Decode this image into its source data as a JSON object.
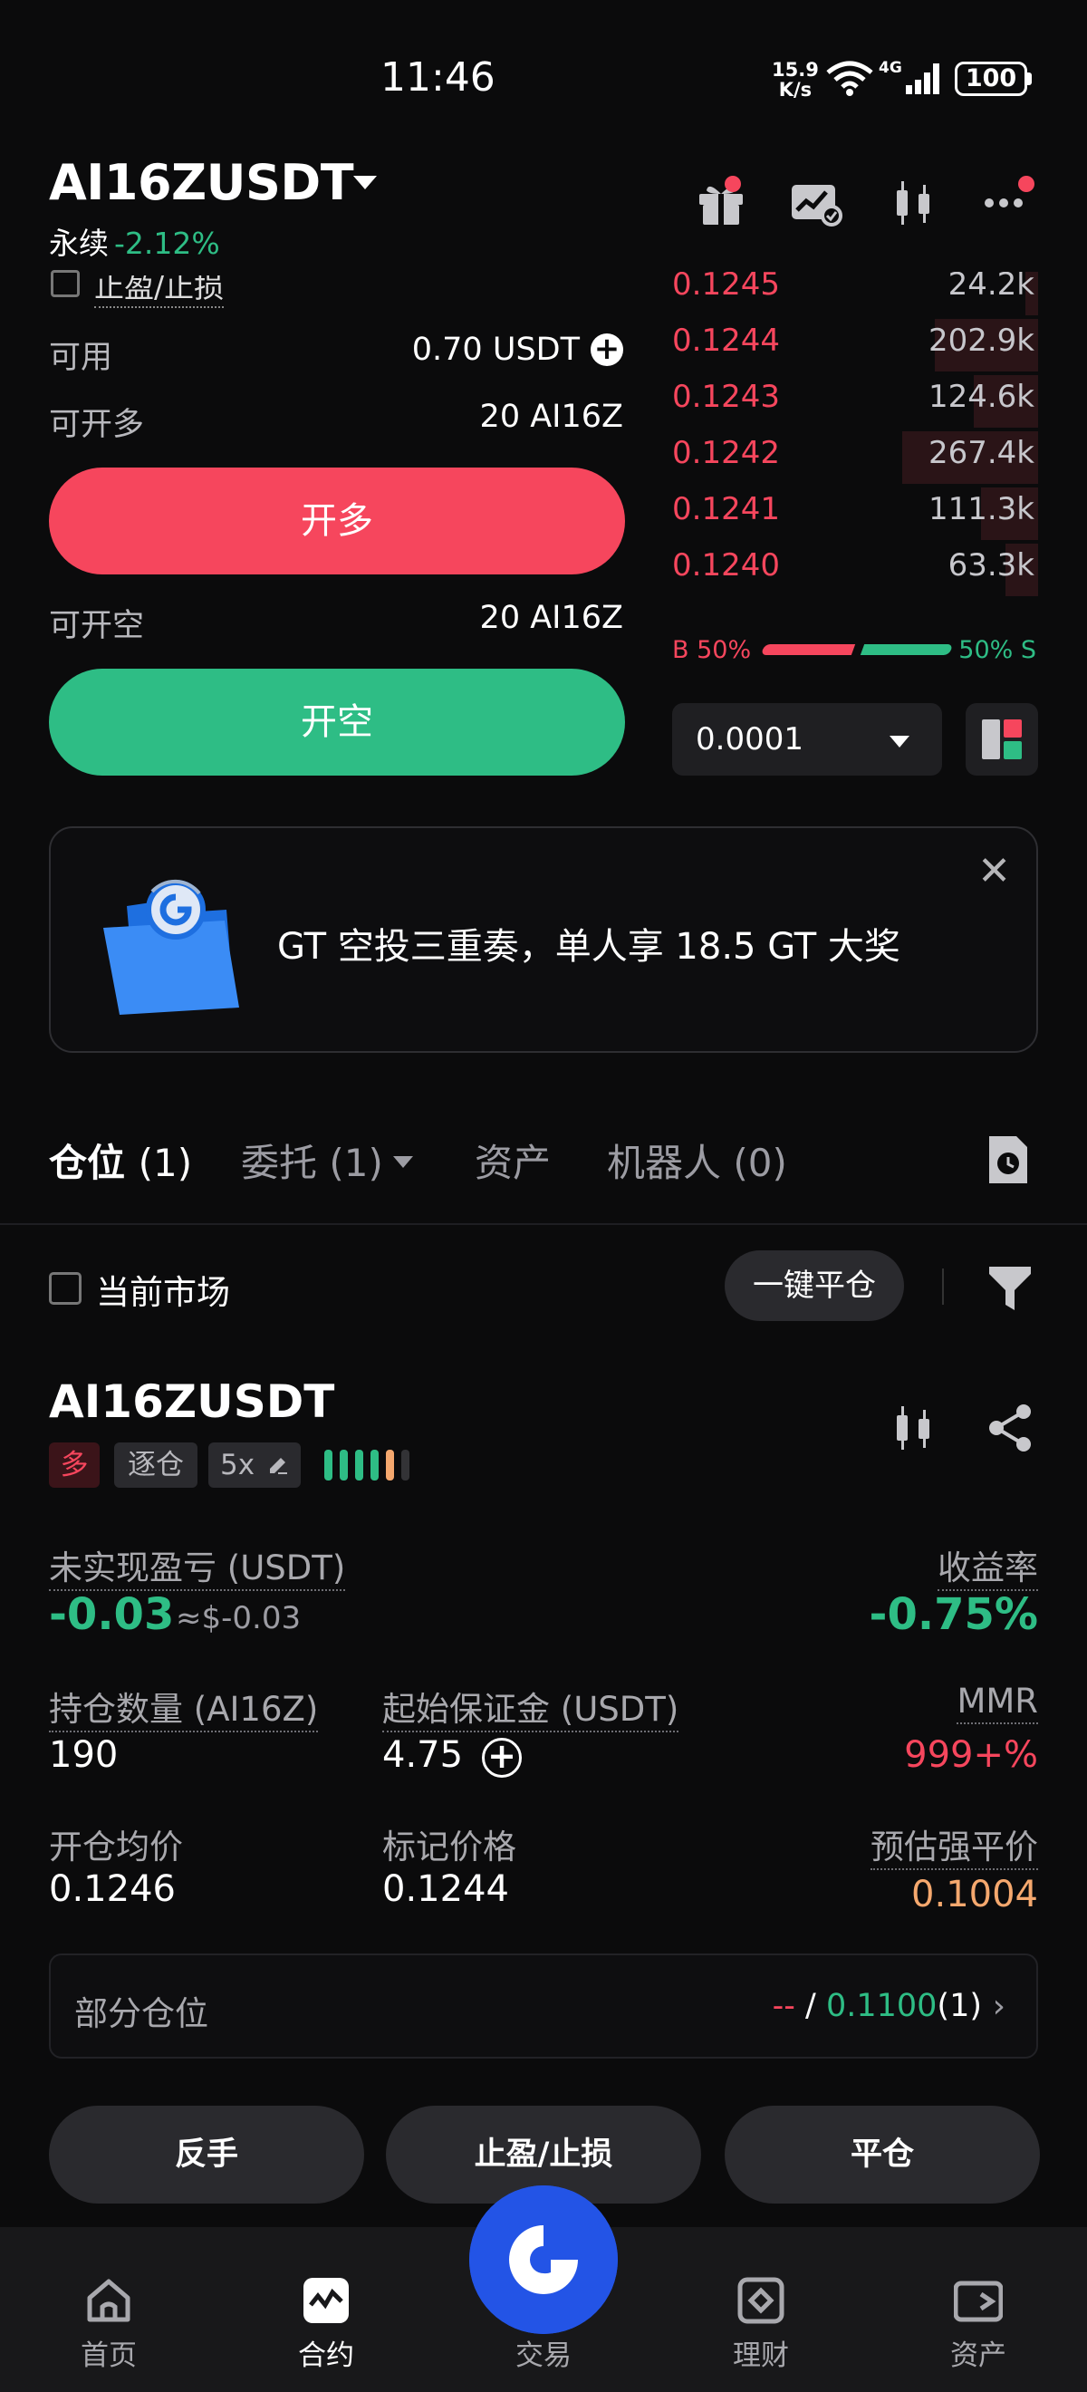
{
  "status_bar": {
    "time": "11:46",
    "net_speed_value": "15.9",
    "net_speed_unit": "K/s",
    "network": "4G",
    "battery": "100"
  },
  "header": {
    "pair": "AI16ZUSDT",
    "contract_type": "永续",
    "change": "-2.12%",
    "icons": [
      "gift-icon",
      "chart-alert-icon",
      "kline-icon",
      "more-icon"
    ]
  },
  "order_form": {
    "tpsl_label": "止盈/止损",
    "available_label": "可用",
    "available_value": "0.70 USDT",
    "max_long_label": "可开多",
    "max_long_value": "20 AI16Z",
    "open_long": "开多",
    "max_short_label": "可开空",
    "max_short_value": "20 AI16Z",
    "open_short": "开空"
  },
  "orderbook": {
    "asks": [
      {
        "price": "0.1245",
        "qty": "24.2k",
        "depth": 0.09
      },
      {
        "price": "0.1244",
        "qty": "202.9k",
        "depth": 0.76
      },
      {
        "price": "0.1243",
        "qty": "124.6k",
        "depth": 0.47
      },
      {
        "price": "0.1242",
        "qty": "267.4k",
        "depth": 1.0
      },
      {
        "price": "0.1241",
        "qty": "111.3k",
        "depth": 0.42
      },
      {
        "price": "0.1240",
        "qty": "63.3k",
        "depth": 0.24
      }
    ],
    "buy_ratio": "B 50%",
    "sell_ratio": "50% S",
    "tick_size": "0.0001"
  },
  "promo": {
    "text": "GT 空投三重奏，单人享 18.5 GT 大奖",
    "close": "✕"
  },
  "tabs": {
    "positions": "仓位",
    "positions_count": "(1)",
    "orders": "委托",
    "orders_count": "(1)",
    "assets": "资产",
    "bots": "机器人",
    "bots_count": "(0)"
  },
  "filters": {
    "current_market": "当前市场",
    "close_all": "一键平仓"
  },
  "position": {
    "symbol": "AI16ZUSDT",
    "side": "多",
    "margin_mode": "逐仓",
    "leverage": "5x",
    "risk_colors": [
      "#2ebd85",
      "#2ebd85",
      "#2ebd85",
      "#2ebd85",
      "#f5a86e",
      "#333336"
    ],
    "unrealized_pnl_label": "未实现盈亏 (USDT)",
    "unrealized_pnl": "-0.03",
    "unrealized_pnl_usd": "≈$-0.03",
    "roe_label": "收益率",
    "roe": "-0.75%",
    "size_label": "持仓数量 (AI16Z)",
    "size": "190",
    "margin_label": "起始保证金 (USDT)",
    "margin": "4.75",
    "mmr_label": "MMR",
    "mmr": "999+%",
    "entry_label": "开仓均价",
    "entry": "0.1246",
    "mark_label": "标记价格",
    "mark": "0.1244",
    "liq_label": "预估强平价",
    "liq": "0.1004",
    "partial_label": "部分仓位",
    "partial_tp": "--",
    "partial_sep": "/",
    "partial_sl": "0.1100",
    "partial_count": "(1)"
  },
  "actions": {
    "reverse": "反手",
    "tpsl": "止盈/止损",
    "close": "平仓"
  },
  "bottom_nav": {
    "home": "首页",
    "futures": "合约",
    "trade": "交易",
    "earn": "理财",
    "assets": "资产"
  }
}
